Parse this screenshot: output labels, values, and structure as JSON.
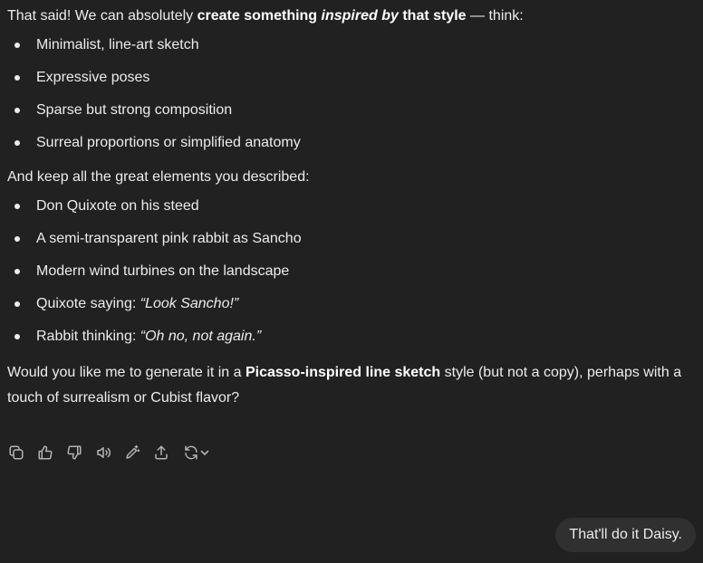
{
  "assistant": {
    "intro": {
      "t1": "That said! We can absolutely ",
      "b1": "create something ",
      "bi": "inspired by",
      "b2": " that style",
      "t2": " — think:"
    },
    "style_points": [
      "Minimalist, line-art sketch",
      "Expressive poses",
      "Sparse but strong composition",
      "Surreal proportions or simplified anatomy"
    ],
    "keep_line": "And keep all the great elements you described:",
    "elements": {
      "e1": "Don Quixote on his steed",
      "e2": "A semi-transparent pink rabbit as Sancho",
      "e3": "Modern wind turbines on the landscape",
      "e4_prefix": "Quixote saying: ",
      "e4_quote": "“Look Sancho!”",
      "e5_prefix": "Rabbit thinking: ",
      "e5_quote": "“Oh no, not again.”"
    },
    "question": {
      "t1": "Would you like me to generate it in a ",
      "bold": "Picasso-inspired line sketch",
      "t2": " style (but not a copy), perhaps with a touch of surrealism or Cubist flavor?"
    }
  },
  "actions": [
    {
      "name": "copy",
      "icon": "copy-icon"
    },
    {
      "name": "good-response",
      "icon": "thumbs-up-icon"
    },
    {
      "name": "bad-response",
      "icon": "thumbs-down-icon"
    },
    {
      "name": "read-aloud",
      "icon": "speaker-icon"
    },
    {
      "name": "edit-in-canvas",
      "icon": "pen-sparkle-icon"
    },
    {
      "name": "share",
      "icon": "share-icon"
    },
    {
      "name": "regenerate",
      "icon": "refresh-icon"
    }
  ],
  "user_message": "That'll do it Daisy.",
  "colors": {
    "background": "#212121",
    "text": "#ececec",
    "user_bubble": "#303030",
    "icon": "#b4b4b4"
  }
}
